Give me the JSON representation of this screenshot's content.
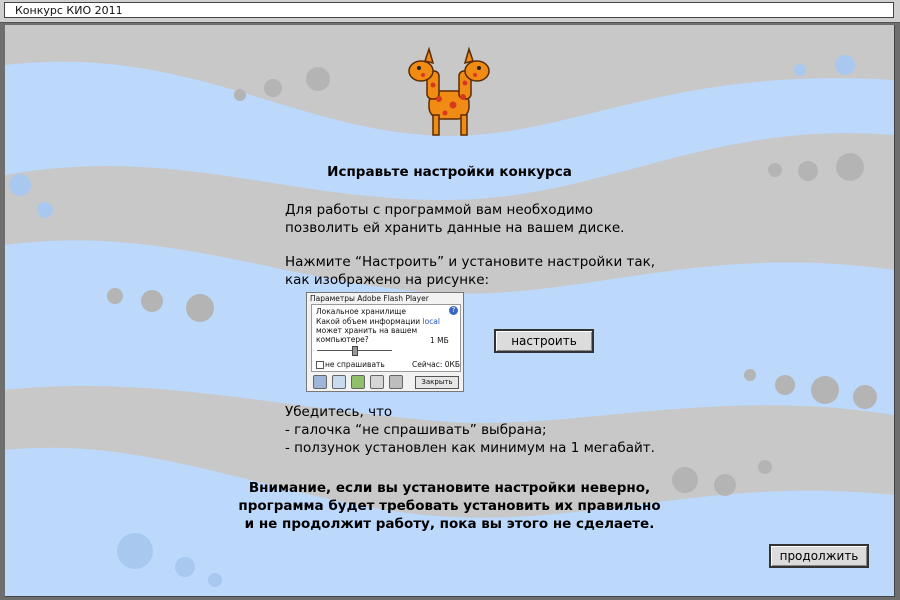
{
  "window": {
    "title": "Конкурс КИО 2011"
  },
  "colors": {
    "stripe_blue": "#bcd8fb",
    "stripe_gray": "#c8c8c8",
    "dot_gray": "#b4b4b4",
    "dot_blue": "#a8c8f0",
    "mascot_orange": "#f08c14",
    "spot_red": "#d83820"
  },
  "heading": "Исправьте настройки конкурса",
  "intro": {
    "line1": "Для работы с программой вам необходимо",
    "line2": "позволить ей хранить данные на вашем диске."
  },
  "instruction": {
    "line1": "Нажмите “Настроить” и установите настройки так,",
    "line2": "как изображено на рисунке:"
  },
  "flash_dialog": {
    "title": "Параметры Adobe Flash Player",
    "section": "Локальное хранилище",
    "question_part1": "Какой объем информации",
    "question_highlight": "local",
    "question_line2": "может хранить на вашем",
    "question_line3": "компьютере?",
    "limit": "1 МБ",
    "dont_ask": "не спрашивать",
    "current": "Сейчас: 0КБ",
    "close_label": "Закрыть",
    "help_glyph": "?",
    "storage_limit_mb": 1
  },
  "configure_button": "настроить",
  "checklist": {
    "line1": "Убедитесь, что",
    "line2": "- галочка “не спрашивать” выбрана;",
    "line3": "- ползунок установлен как минимум на 1 мегабайт."
  },
  "warning": {
    "line1": "Внимание, если вы установите настройки неверно,",
    "line2": "программа будет требовать установить их правильно",
    "line3": "и не продолжит работу, пока вы этого не сделаете."
  },
  "continue_button": "продолжить"
}
